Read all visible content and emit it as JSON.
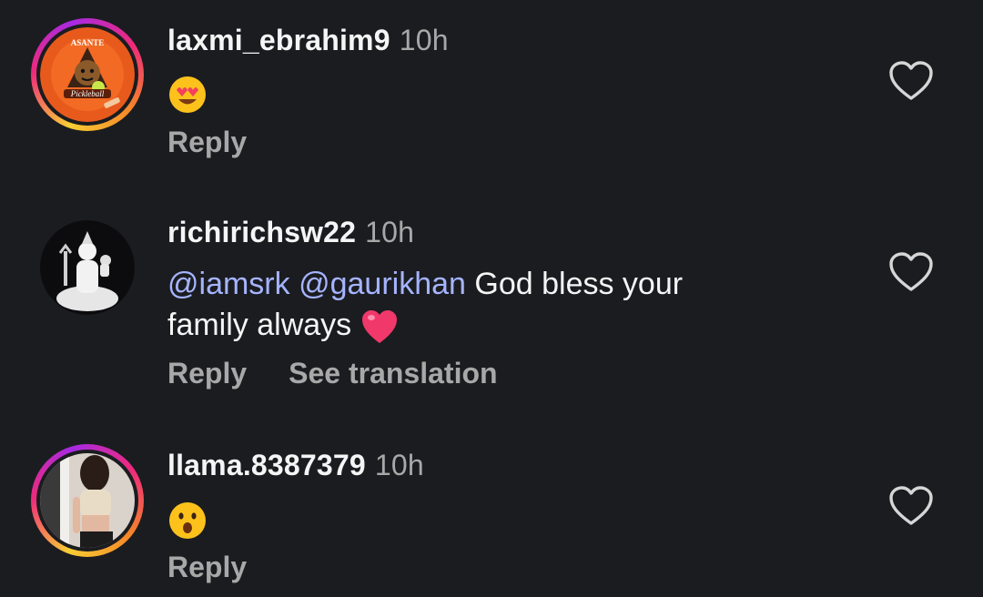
{
  "comments": [
    {
      "username": "laxmi_ebrahim9",
      "time": "10h",
      "avatar": {
        "ring": true,
        "logo_text_top": "ASANTE",
        "logo_text_bottom": "Pickleball"
      },
      "emoji": "heart-eyes-emoji",
      "reply": "Reply"
    },
    {
      "username": "richirichsw22",
      "time": "10h",
      "avatar": {
        "ring": false
      },
      "mention_1": "@iamsrk",
      "mention_2": "@gaurikhan",
      "text_1": "God bless your",
      "text_2": "family always",
      "emoji": "red-heart-emoji",
      "reply": "Reply",
      "translate": "See translation"
    },
    {
      "username": "llama.8387379",
      "time": "10h",
      "avatar": {
        "ring": true
      },
      "emoji": "surprised-face-emoji",
      "reply": "Reply"
    }
  ],
  "colors": {
    "background": "#1b1c20",
    "mention": "#a5b4ff",
    "muted": "#a8a8a8"
  },
  "icons": {
    "like": "heart-outline-icon"
  }
}
